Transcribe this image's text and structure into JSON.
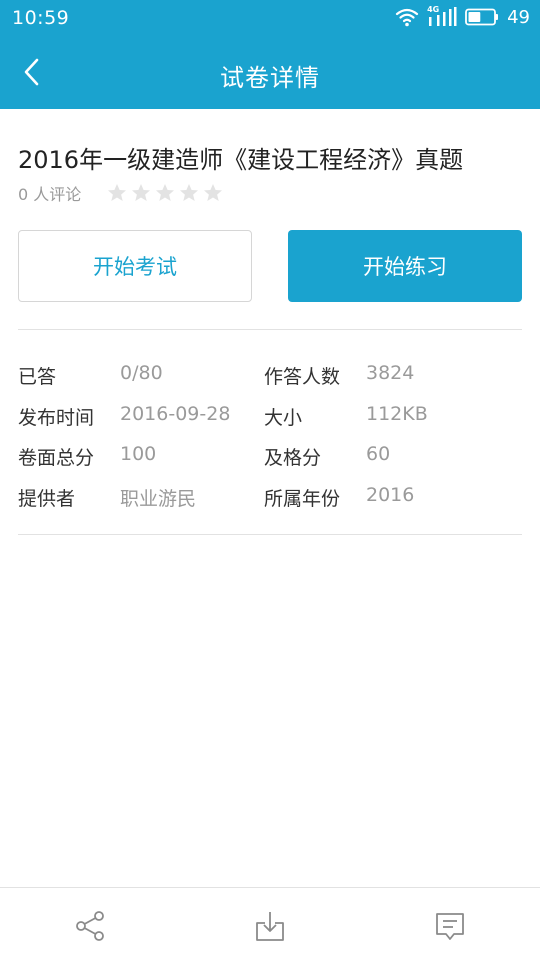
{
  "status_bar": {
    "time": "10:59",
    "network_label": "4G",
    "battery": "49"
  },
  "header": {
    "title": "试卷详情"
  },
  "paper": {
    "title": "2016年一级建造师《建设工程经济》真题",
    "review_count": "0 人评论",
    "rating": 0,
    "rating_max": 5
  },
  "actions": {
    "start_exam": "开始考试",
    "start_practice": "开始练习"
  },
  "info": [
    {
      "label": "已答",
      "value": "0/80",
      "label2": "作答人数",
      "value2": "3824"
    },
    {
      "label": "发布时间",
      "value": "2016-09-28",
      "label2": "大小",
      "value2": "112KB"
    },
    {
      "label": "卷面总分",
      "value": "100",
      "label2": "及格分",
      "value2": "60"
    },
    {
      "label": "提供者",
      "value": "职业游民",
      "label2": "所属年份",
      "value2": "2016"
    }
  ],
  "colors": {
    "primary": "#1aa3cf",
    "star_empty": "#e3e3e3",
    "icon_gray": "#8a8a8a"
  },
  "bottom_icons": [
    "share-icon",
    "download-icon",
    "comment-icon"
  ]
}
